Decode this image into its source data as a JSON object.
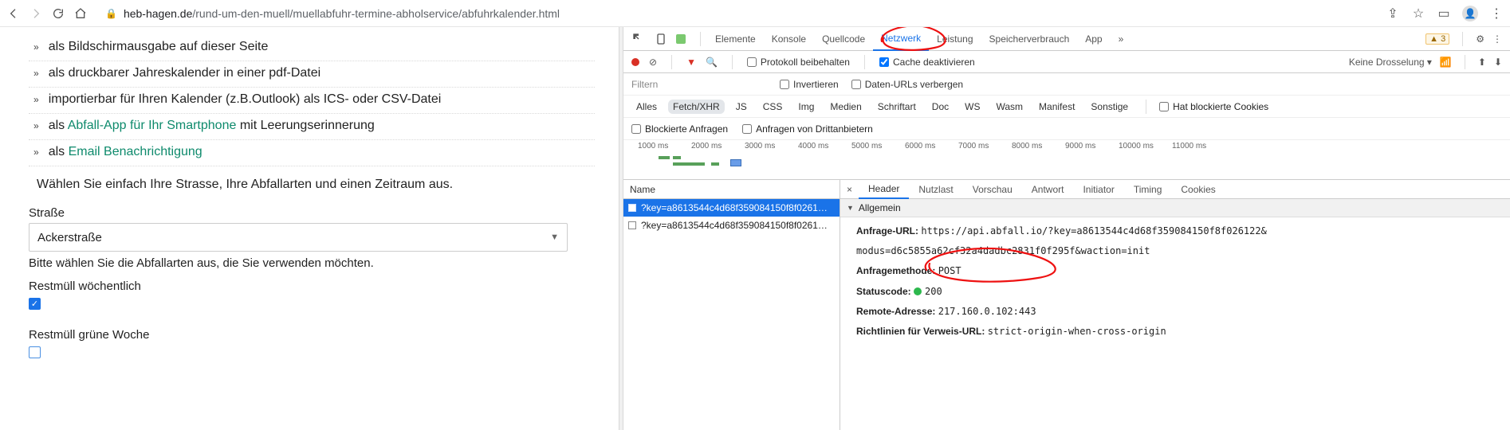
{
  "toolbar": {
    "url_host": "heb-hagen.de",
    "url_path": "/rund-um-den-muell/muellabfuhr-termine-abholservice/abfuhrkalender.html"
  },
  "page": {
    "items": [
      {
        "prefix": "als ",
        "text": "Bildschirmausgabe auf dieser Seite",
        "link": false
      },
      {
        "prefix": "als ",
        "text": "druckbarer Jahreskalender in einer pdf-Datei",
        "link": false
      },
      {
        "prefix": "",
        "text": "importierbar für Ihren Kalender (z.B.Outlook) als ICS- oder CSV-Datei",
        "link": false
      },
      {
        "prefix": "als ",
        "text": "Abfall-App für Ihr Smartphone",
        "suffix": " mit Leerungserinnerung",
        "link": true
      },
      {
        "prefix": "als ",
        "text": "Email Benachrichtigung",
        "link": true
      }
    ],
    "choose_text": "Wählen Sie einfach Ihre Strasse, Ihre Abfallarten und einen Zeitraum aus.",
    "street_label": "Straße",
    "street_value": "Ackerstraße",
    "types_hint": "Bitte wählen Sie die Abfallarten aus, die Sie verwenden möchten.",
    "chk1_label": "Restmüll wöchentlich",
    "chk2_label": "Restmüll grüne Woche"
  },
  "devtools": {
    "tabs": [
      "Elemente",
      "Konsole",
      "Quellcode",
      "Netzwerk",
      "Leistung",
      "Speicherverbrauch",
      "App"
    ],
    "active_tab": "Netzwerk",
    "warn_count": "3",
    "toolbar2": {
      "preserve": "Protokoll beibehalten",
      "disable_cache": "Cache deaktivieren",
      "throttle": "Keine Drosselung"
    },
    "filterbar": {
      "filter_ph": "Filtern",
      "invert": "Invertieren",
      "hide_dataurls": "Daten-URLs verbergen"
    },
    "types": [
      "Alles",
      "Fetch/XHR",
      "JS",
      "CSS",
      "Img",
      "Medien",
      "Schriftart",
      "Doc",
      "WS",
      "Wasm",
      "Manifest",
      "Sonstige"
    ],
    "types_extra": "Hat blockierte Cookies",
    "more_filters": {
      "blocked": "Blockierte Anfragen",
      "thirdparty": "Anfragen von Drittanbietern"
    },
    "timeline_ticks": [
      "1000 ms",
      "2000 ms",
      "3000 ms",
      "4000 ms",
      "5000 ms",
      "6000 ms",
      "7000 ms",
      "8000 ms",
      "9000 ms",
      "10000 ms",
      "11000 ms"
    ],
    "req_header": "Name",
    "requests": [
      {
        "name": "?key=a8613544c4d68f359084150f8f0261…",
        "selected": true
      },
      {
        "name": "?key=a8613544c4d68f359084150f8f0261…",
        "selected": false
      }
    ],
    "detail_tabs": [
      "Header",
      "Nutzlast",
      "Vorschau",
      "Antwort",
      "Initiator",
      "Timing",
      "Cookies"
    ],
    "detail_active": "Header",
    "section_general": "Allgemein",
    "kv": {
      "url_label": "Anfrage-URL:",
      "url_value_1": "https://api.abfall.io/?key=a8613544c4d68f359084150f8f026122&",
      "url_value_2": "modus=d6c5855a62cf32a4dadbc2831f0f295f&waction=init",
      "method_label": "Anfragemethode:",
      "method_value": "POST",
      "status_label": "Statuscode:",
      "status_value": "200",
      "remote_label": "Remote-Adresse:",
      "remote_value": "217.160.0.102:443",
      "refpolicy_label": "Richtlinien für Verweis-URL:",
      "refpolicy_value": "strict-origin-when-cross-origin"
    }
  }
}
